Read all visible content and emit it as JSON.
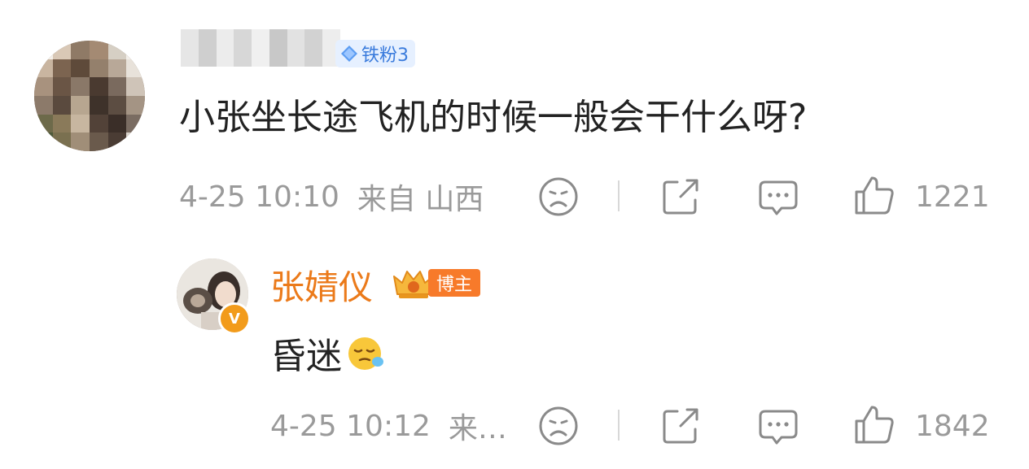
{
  "comment": {
    "fan_badge": "铁粉3",
    "text": "小张坐长途飞机的时候一般会干什么呀?",
    "time": "4-25 10:10",
    "source": "来自 山西",
    "likes": "1221"
  },
  "reply": {
    "name": "张婧仪",
    "role_tag": "博主",
    "text": "昏迷",
    "emoji": "sleepy-face-icon",
    "time": "4-25 10:12",
    "source_truncated": "来…",
    "likes": "1842"
  },
  "colors": {
    "name_orange": "#eb7a1a",
    "meta_gray": "#9a9a9a",
    "fan_badge_blue": "#3a7bdc",
    "blogger_tag": "#f77a2a"
  }
}
